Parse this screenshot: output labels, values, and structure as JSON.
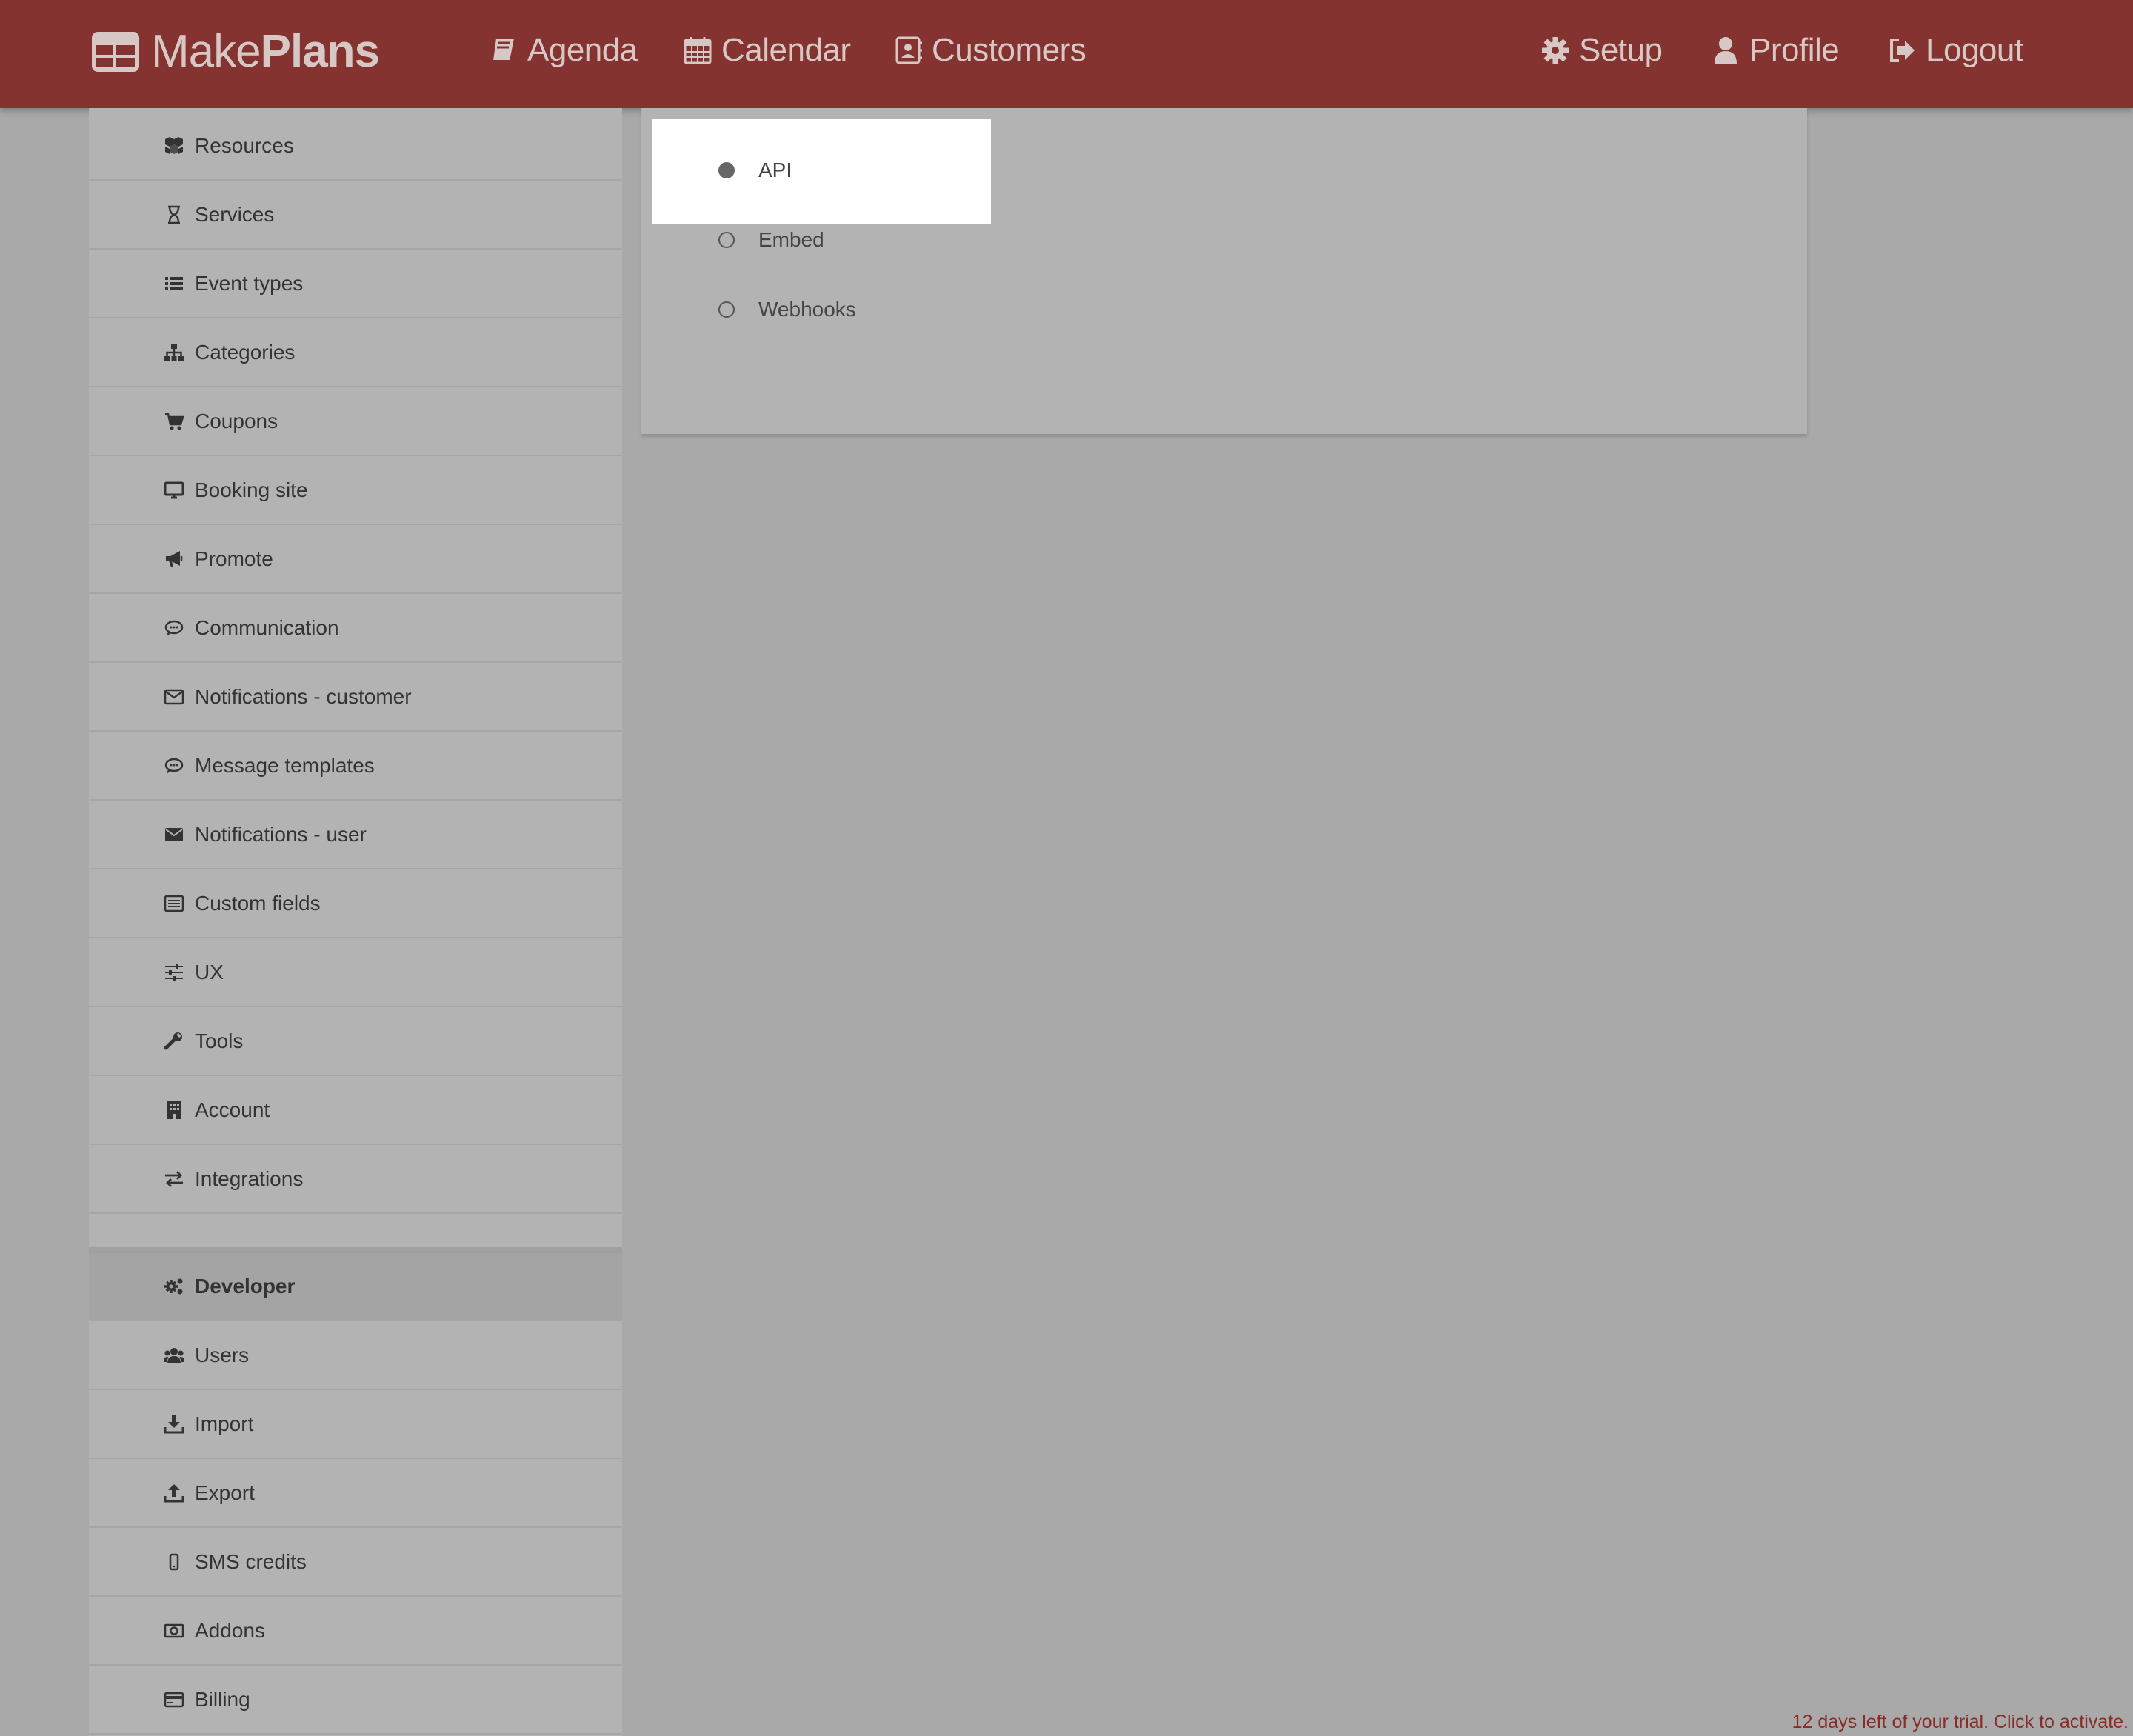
{
  "colors": {
    "brand": "#843330",
    "nav_text": "#d7c8c6",
    "trial_text": "#8a2b27"
  },
  "logo": {
    "part1": "Make",
    "part2": "Plans",
    "icon": "calendar-grid-icon"
  },
  "nav": {
    "agenda": "Agenda",
    "calendar": "Calendar",
    "customers": "Customers",
    "setup": "Setup",
    "profile": "Profile",
    "logout": "Logout"
  },
  "sidebar": {
    "items": [
      {
        "label": "Resources",
        "icon": "cubes-icon"
      },
      {
        "label": "Services",
        "icon": "hourglass-icon"
      },
      {
        "label": "Event types",
        "icon": "list-icon"
      },
      {
        "label": "Categories",
        "icon": "sitemap-icon"
      },
      {
        "label": "Coupons",
        "icon": "cart-icon"
      },
      {
        "label": "Booking site",
        "icon": "desktop-icon"
      },
      {
        "label": "Promote",
        "icon": "bullhorn-icon"
      },
      {
        "label": "Communication",
        "icon": "comment-icon"
      },
      {
        "label": "Notifications - customer",
        "icon": "envelope-outline-icon"
      },
      {
        "label": "Message templates",
        "icon": "comment-icon"
      },
      {
        "label": "Notifications - user",
        "icon": "envelope-icon"
      },
      {
        "label": "Custom fields",
        "icon": "list-alt-icon"
      },
      {
        "label": "UX",
        "icon": "sliders-icon"
      },
      {
        "label": "Tools",
        "icon": "wrench-icon"
      },
      {
        "label": "Account",
        "icon": "building-icon"
      },
      {
        "label": "Integrations",
        "icon": "exchange-icon"
      },
      {
        "label": "Developer",
        "icon": "cogs-icon"
      },
      {
        "label": "Users",
        "icon": "users-icon"
      },
      {
        "label": "Import",
        "icon": "download-icon"
      },
      {
        "label": "Export",
        "icon": "upload-icon"
      },
      {
        "label": "SMS credits",
        "icon": "mobile-icon"
      },
      {
        "label": "Addons",
        "icon": "money-icon"
      },
      {
        "label": "Billing",
        "icon": "credit-card-icon"
      }
    ],
    "active": "Developer"
  },
  "developer_options": [
    {
      "label": "API",
      "selected": true
    },
    {
      "label": "Embed",
      "selected": false
    },
    {
      "label": "Webhooks",
      "selected": false
    }
  ],
  "trial": "12 days left of your trial. Click to activate."
}
